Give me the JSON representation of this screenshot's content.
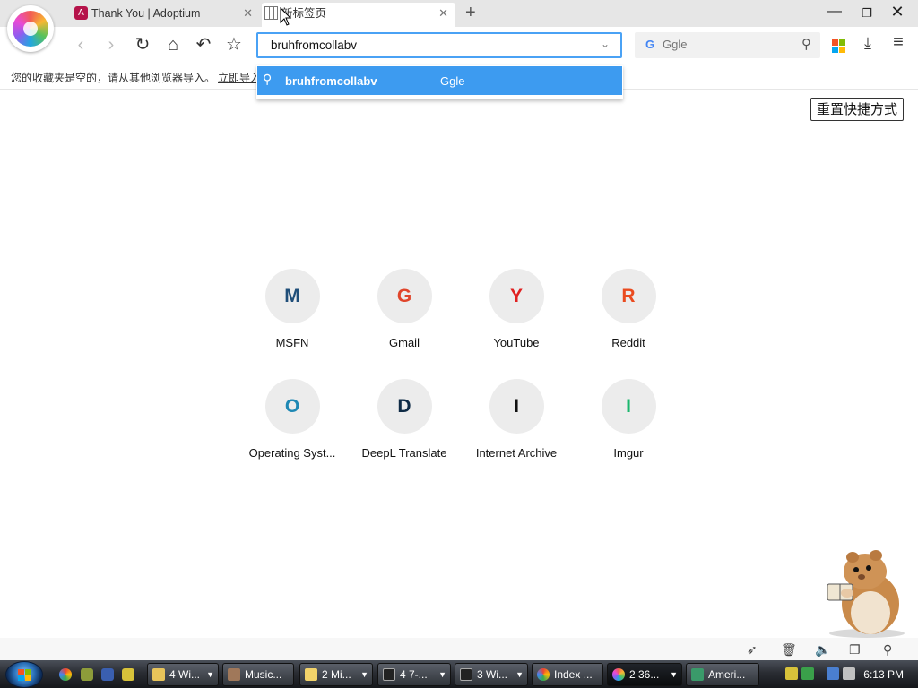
{
  "tabs": [
    {
      "title": "Thank You | Adoptium",
      "icon": "adoptium-icon"
    },
    {
      "title": "新标签页",
      "icon": "grid-icon"
    }
  ],
  "new_tab_symbol": "+",
  "window_controls": {
    "minimize": "—",
    "maximize": "❐",
    "close": "✕"
  },
  "toolbar": {
    "back": "‹",
    "forward": "›",
    "reload": "↻",
    "home": "⌂",
    "undo": "↶",
    "bookmark": "☆",
    "download": "⤓",
    "menu": "≡"
  },
  "omnibox": {
    "value": "bruhfromcollabv",
    "dropdown_caret": "⌄"
  },
  "search_engine_box": {
    "engine_letter": "G",
    "placeholder": "Ggle"
  },
  "bookmarks_bar": {
    "hint": "您的收藏夹是空的，请从其他浏览器导入。",
    "import_link": "立即导入"
  },
  "suggestion": {
    "query": "bruhfromcollabv",
    "engine": "Ggle"
  },
  "reset_button": "重置快捷方式",
  "shortcuts": [
    {
      "letter": "M",
      "label": "MSFN",
      "color": "#1f4e79"
    },
    {
      "letter": "G",
      "label": "Gmail",
      "color": "#e0452b"
    },
    {
      "letter": "Y",
      "label": "YouTube",
      "color": "#e02020"
    },
    {
      "letter": "R",
      "label": "Reddit",
      "color": "#ea4b1f"
    },
    {
      "letter": "O",
      "label": "Operating Syst...",
      "color": "#1e88b4"
    },
    {
      "letter": "D",
      "label": "DeepL Translate",
      "color": "#0f2b46"
    },
    {
      "letter": "I",
      "label": "Internet Archive",
      "color": "#111111"
    },
    {
      "letter": "I",
      "label": "Imgur",
      "color": "#1bb76e"
    }
  ],
  "taskbar": {
    "tasks": [
      {
        "label": "4 Wi...",
        "icon_color": "#e8c45a",
        "has_menu": true
      },
      {
        "label": "Music...",
        "icon_color": "#a0785a",
        "has_menu": false
      },
      {
        "label": "2 Mi...",
        "icon_color": "#f2d36a",
        "has_menu": true
      },
      {
        "label": "4 7-...",
        "icon_color": "#222222",
        "has_menu": true
      },
      {
        "label": "3 Wi...",
        "icon_color": "#222222",
        "has_menu": true
      },
      {
        "label": "Index ...",
        "icon_color": "#4caf50",
        "has_menu": false
      },
      {
        "label": "2 36...",
        "icon_color": "#e94bd6",
        "has_menu": true
      },
      {
        "label": "Ameri...",
        "icon_color": "#3a9a6a",
        "has_menu": false
      }
    ],
    "clock": "6:13 PM"
  },
  "accent_color": "#3d9bf0"
}
